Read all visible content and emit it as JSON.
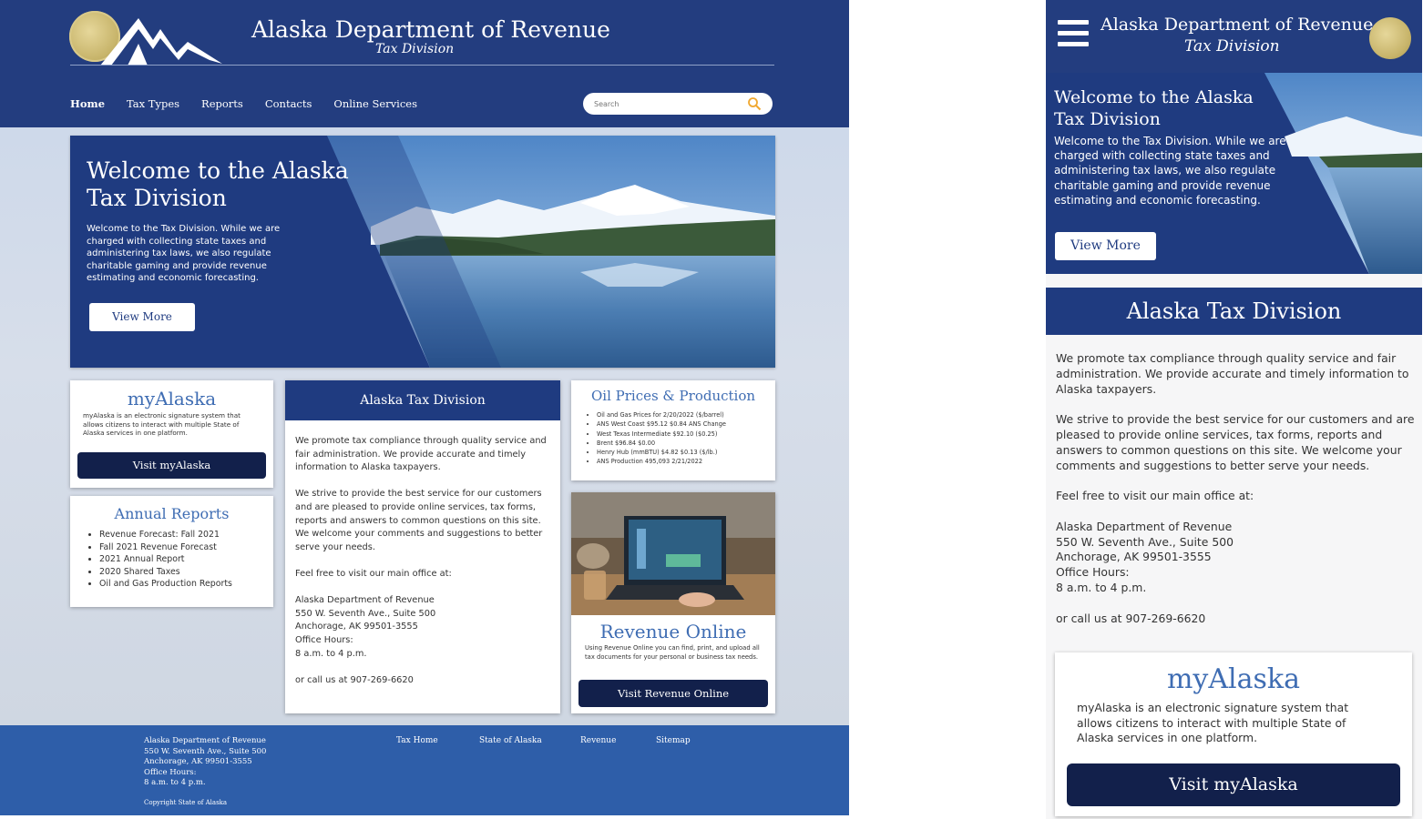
{
  "brand": {
    "title": "Alaska Department of Revenue",
    "subtitle": "Tax Division",
    "colors": {
      "navy": "#233d7f",
      "hero": "#1f3b80",
      "button_dark": "#12204b",
      "accent_blue": "#3f6db3",
      "footer": "#2e5ea9",
      "seal_gold": "#c7b46a"
    }
  },
  "desktop": {
    "nav": {
      "items": [
        {
          "label": "Home",
          "active": true
        },
        {
          "label": "Tax Types"
        },
        {
          "label": "Reports"
        },
        {
          "label": "Contacts"
        },
        {
          "label": "Online Services"
        }
      ],
      "search_placeholder": "Search",
      "search_icon": "search-icon"
    },
    "hero": {
      "title": "Welcome to the Alaska Tax Division",
      "text": "Welcome to the Tax Division. While we are charged with collecting state taxes and administering tax laws, we also regulate charitable gaming and provide revenue estimating and economic forecasting.",
      "button": "View More"
    },
    "myalaska": {
      "title": "myAlaska",
      "text": "myAlaska is an electronic signature system that allows citizens to interact with multiple State of Alaska services in one platform.",
      "button": "Visit myAlaska"
    },
    "annual_reports": {
      "title": "Annual Reports",
      "items": [
        "Revenue Forecast: Fall 2021",
        "Fall 2021 Revenue Forecast",
        "2021 Annual Report",
        "2020 Shared Taxes",
        "Oil and Gas Production Reports"
      ]
    },
    "tax_division": {
      "title": "Alaska Tax Division",
      "p1": "We promote tax compliance through quality service and fair administration. We provide accurate and timely information to Alaska taxpayers.",
      "p2": "We strive to provide the best service for our customers and are pleased to provide online services, tax forms, reports and answers to common questions on this site. We welcome your comments and suggestions to better serve your needs.",
      "p3": "Feel free to visit our main office at:",
      "address": [
        "Alaska Department of Revenue",
        "550 W. Seventh Ave., Suite 500",
        "Anchorage, AK 99501-3555",
        "Office Hours:",
        "8 a.m. to 4 p.m."
      ],
      "phone": "or call us at 907-269-6620"
    },
    "oil": {
      "title": "Oil Prices & Production",
      "items": [
        "Oil and Gas Prices for 2/20/2022 ($/barrel)",
        "ANS West Coast $95.12 $0.84 ANS Change",
        "West Texas Intermediate $92.10 ($0.25)",
        "Brent $96.84 $0.00",
        "Henry Hub (mmBTU) $4.82 $0.13 ($/lb.)",
        "ANS Production 495,093 2/21/2022"
      ]
    },
    "revenue_online": {
      "title": "Revenue Online",
      "text": "Using Revenue Online you can find, print, and upload all tax documents for your personal or business tax needs.",
      "button": "Visit Revenue Online"
    },
    "footer": {
      "address": [
        "Alaska Department of Revenue",
        "550 W. Seventh Ave., Suite 500",
        "Anchorage, AK 99501-3555",
        "Office Hours:",
        "8 a.m. to 4 p.m."
      ],
      "copyright": "Copyright State of Alaska",
      "links": [
        "Tax Home",
        "State of Alaska",
        "Revenue",
        "Sitemap"
      ]
    }
  },
  "mobile": {
    "menu_icon": "hamburger-menu-icon",
    "hero": {
      "title": "Welcome to the Alaska Tax Division",
      "text": "Welcome to the Tax Division. While we are charged with collecting state taxes and administering tax laws, we also regulate charitable gaming and provide revenue estimating and economic forecasting.",
      "button": "View More"
    },
    "section_title": "Alaska Tax Division",
    "p1": "We promote tax compliance through quality service and fair administration. We provide accurate and timely information to Alaska taxpayers.",
    "p2": "We strive to provide the best service for our customers and are pleased to provide online services, tax forms, reports and answers to common questions on this site. We welcome your comments and suggestions to better serve your needs.",
    "p3": "Feel free to visit our main office at:",
    "address": [
      "Alaska Department of Revenue",
      "550 W. Seventh Ave., Suite 500",
      "Anchorage, AK 99501-3555",
      "Office Hours:",
      "8 a.m. to 4 p.m."
    ],
    "phone": "or call us at 907-269-6620",
    "myalaska": {
      "title": "myAlaska",
      "text": "myAlaska is an electronic signature system that allows citizens to interact with multiple State of Alaska services in one platform.",
      "button": "Visit myAlaska"
    }
  }
}
